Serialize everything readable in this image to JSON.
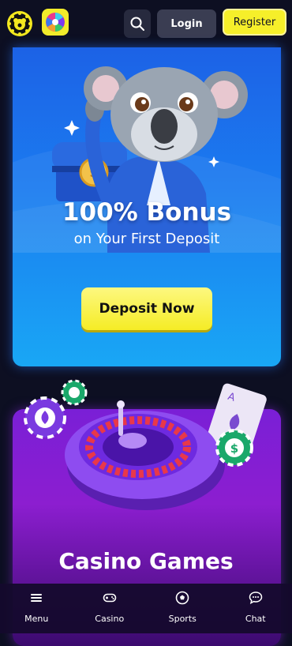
{
  "header": {
    "login_label": "Login",
    "register_label": "Register",
    "icons": [
      "logo-icon",
      "wheel-icon",
      "search-icon"
    ]
  },
  "promo": {
    "title": "100% Bonus",
    "subtitle": "on Your First Deposit",
    "cta_label": "Deposit Now"
  },
  "casino": {
    "title": "Casino Games"
  },
  "nav": {
    "items": [
      {
        "label": "Menu",
        "icon": "hamburger-icon"
      },
      {
        "label": "Casino",
        "icon": "gamepad-icon"
      },
      {
        "label": "Sports",
        "icon": "soccer-ball-icon"
      },
      {
        "label": "Chat",
        "icon": "chat-bubble-icon"
      }
    ]
  },
  "colors": {
    "background": "#0d0f22",
    "accent_yellow": "#f6ef2a",
    "promo_blue": "#1b7cf0",
    "casino_purple": "#8c1ed0"
  }
}
